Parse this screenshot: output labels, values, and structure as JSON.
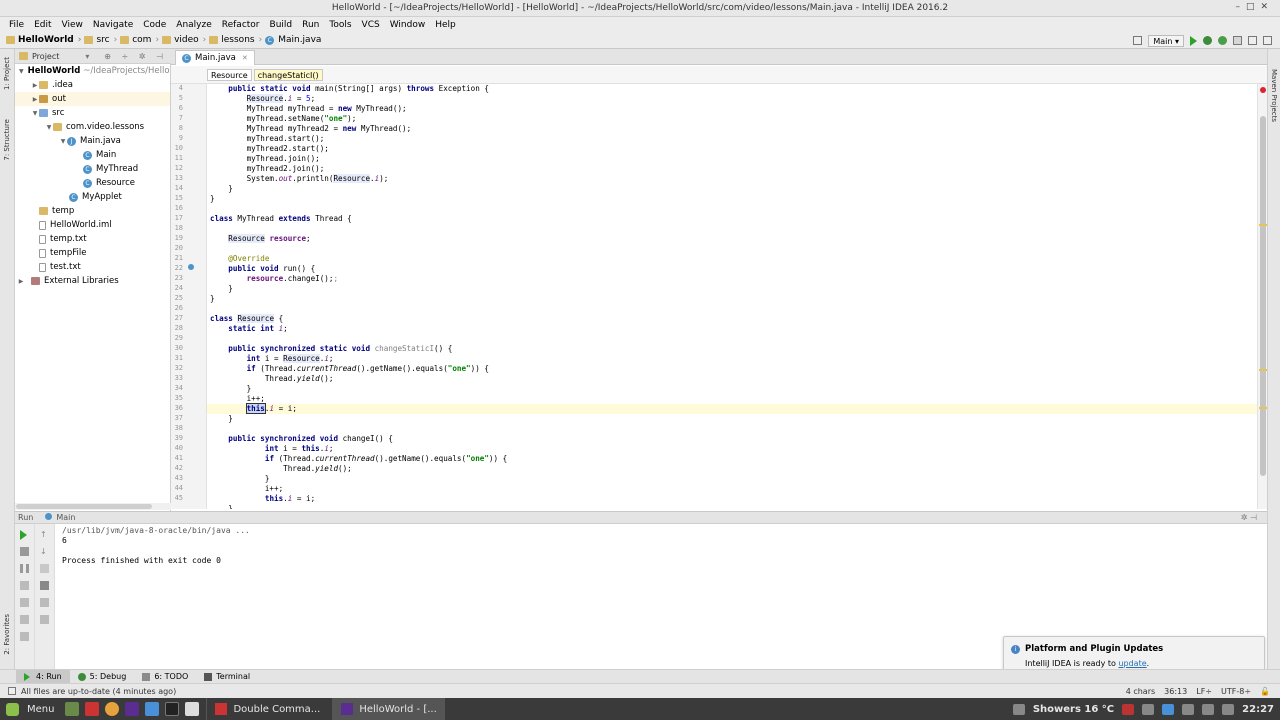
{
  "window": {
    "title": "HelloWorld - [~/IdeaProjects/HelloWorld] - [HelloWorld] - ~/IdeaProjects/HelloWorld/src/com/video/lessons/Main.java - IntelliJ IDEA 2016.2"
  },
  "menu": [
    "File",
    "Edit",
    "View",
    "Navigate",
    "Code",
    "Analyze",
    "Refactor",
    "Build",
    "Run",
    "Tools",
    "VCS",
    "Window",
    "Help"
  ],
  "breadcrumb": [
    "HelloWorld",
    "src",
    "com",
    "video",
    "lessons",
    "Main.java"
  ],
  "toolbar": {
    "run_config": "Main ▾"
  },
  "left_strip": {
    "project": "1: Project",
    "structure": "7: Structure",
    "favorites": "2: Favorites"
  },
  "right_strip": {
    "maven": "Maven Projects"
  },
  "project_panel": {
    "header": "Project",
    "tree": [
      {
        "label": "HelloWorld",
        "extra": "~/IdeaProjects/HelloW"
      },
      {
        "label": ".idea"
      },
      {
        "label": "out"
      },
      {
        "label": "src"
      },
      {
        "label": "com.video.lessons"
      },
      {
        "label": "Main.java"
      },
      {
        "label": "Main"
      },
      {
        "label": "MyThread"
      },
      {
        "label": "Resource"
      },
      {
        "label": "MyApplet"
      },
      {
        "label": "temp"
      },
      {
        "label": "HelloWorld.iml"
      },
      {
        "label": "temp.txt"
      },
      {
        "label": "tempFile"
      },
      {
        "label": "test.txt"
      },
      {
        "label": "External Libraries"
      }
    ]
  },
  "editor": {
    "tab": "Main.java",
    "crumbs": [
      "Resource",
      "changeStaticI()"
    ],
    "line_numbers": [
      "4",
      "5",
      "6",
      "7",
      "8",
      "9",
      "10",
      "11",
      "12",
      "13",
      "14",
      "15",
      "16",
      "17",
      "18",
      "19",
      "20",
      "21",
      "22",
      "23",
      "24",
      "25",
      "26",
      "27",
      "28",
      "29",
      "30",
      "31",
      "32",
      "33",
      "34",
      "35",
      "36",
      "37",
      "38",
      "39",
      "40",
      "41",
      "42",
      "43",
      "44",
      "45"
    ]
  },
  "run_panel": {
    "title": "Run",
    "config": "Main",
    "console": [
      "/usr/lib/jvm/java-8-oracle/bin/java ...",
      "6",
      "",
      "Process finished with exit code 0"
    ]
  },
  "bottom_tabs": [
    "4: Run",
    "5: Debug",
    "6: TODO",
    "Terminal"
  ],
  "status": {
    "message": "All files are up-to-date (4 minutes ago)",
    "chars": "4 chars",
    "pos": "36:13",
    "lf": "LF÷",
    "enc": "UTF-8÷"
  },
  "notification": {
    "title": "Platform and Plugin Updates",
    "text": "IntelliJ IDEA is ready to ",
    "link": "update",
    "suffix": "."
  },
  "taskbar": {
    "menu": "Menu",
    "tasks": [
      "Double Comma...",
      "HelloWorld - [..."
    ],
    "weather": "Showers 16 °C",
    "clock": "22:27"
  }
}
